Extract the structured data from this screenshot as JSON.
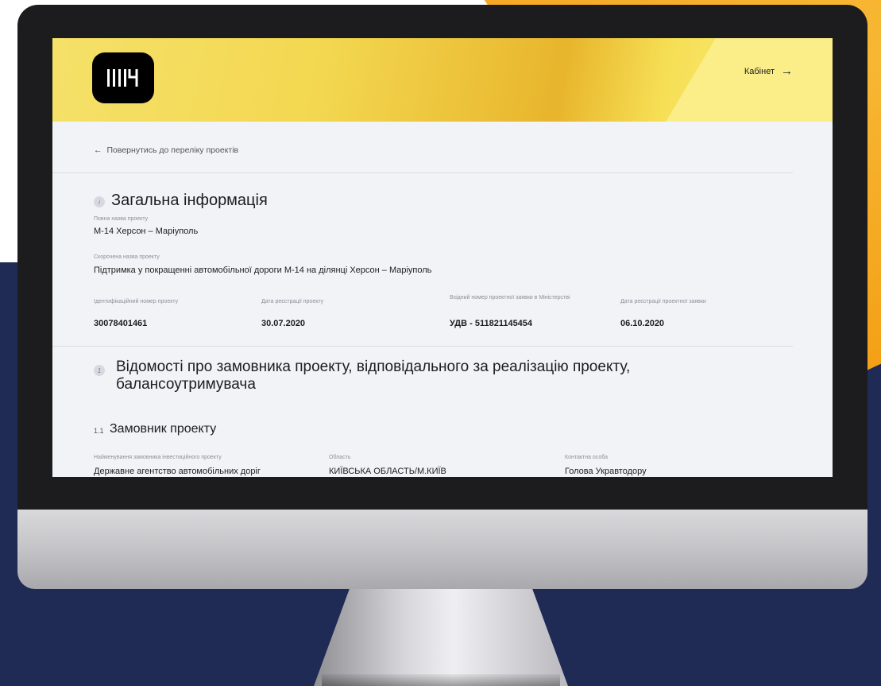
{
  "colors": {
    "navy": "#1f2a55",
    "orange": "#f5a623",
    "header_yellow": "#f3d750"
  },
  "header": {
    "logo_text": "IIIIЧ",
    "cabinet_label": "Кабінет",
    "cabinet_icon": "arrow-right-icon"
  },
  "nav": {
    "back_label": "Повернутись до переліку проектів",
    "back_icon": "arrow-left-icon"
  },
  "general_info": {
    "icon": "i",
    "title": "Загальна інформація",
    "full_name_label": "Повна назва проекту",
    "full_name_value": "М-14 Херсон – Маріуполь",
    "short_name_label": "Скорочена назва проекту",
    "short_name_value": "Підтримка у покращенні автомобільної дороги М-14 на ділянці Херсон – Маріуполь",
    "fields": [
      {
        "label": "Ідентифікаційний номер проекту",
        "value": "30078401461"
      },
      {
        "label": "Дата реєстрації проекту",
        "value": "30.07.2020"
      },
      {
        "label": "Вхідний номер проектної заявки в Міністерстві",
        "value": "УДВ - 511821145454"
      },
      {
        "label": "Дата реєстрації проектної заявки",
        "value": "06.10.2020"
      }
    ]
  },
  "section1": {
    "number": "1",
    "title_line1": "Відомості про замовника проекту, відповідального за реалізацію проекту,",
    "title_line2": "балансоутримувача"
  },
  "section11": {
    "number": "1.1",
    "title": "Замовник проекту",
    "fields": [
      {
        "label": "Найменування замовника інвестиційного проекту",
        "value": "Державне агентство автомобільних доріг"
      },
      {
        "label": "Область",
        "value": "КИЇВСЬКА ОБЛАСТЬ/М.КИЇВ"
      },
      {
        "label": "Контактна особа",
        "value": "Голова Укравтодору"
      }
    ]
  }
}
